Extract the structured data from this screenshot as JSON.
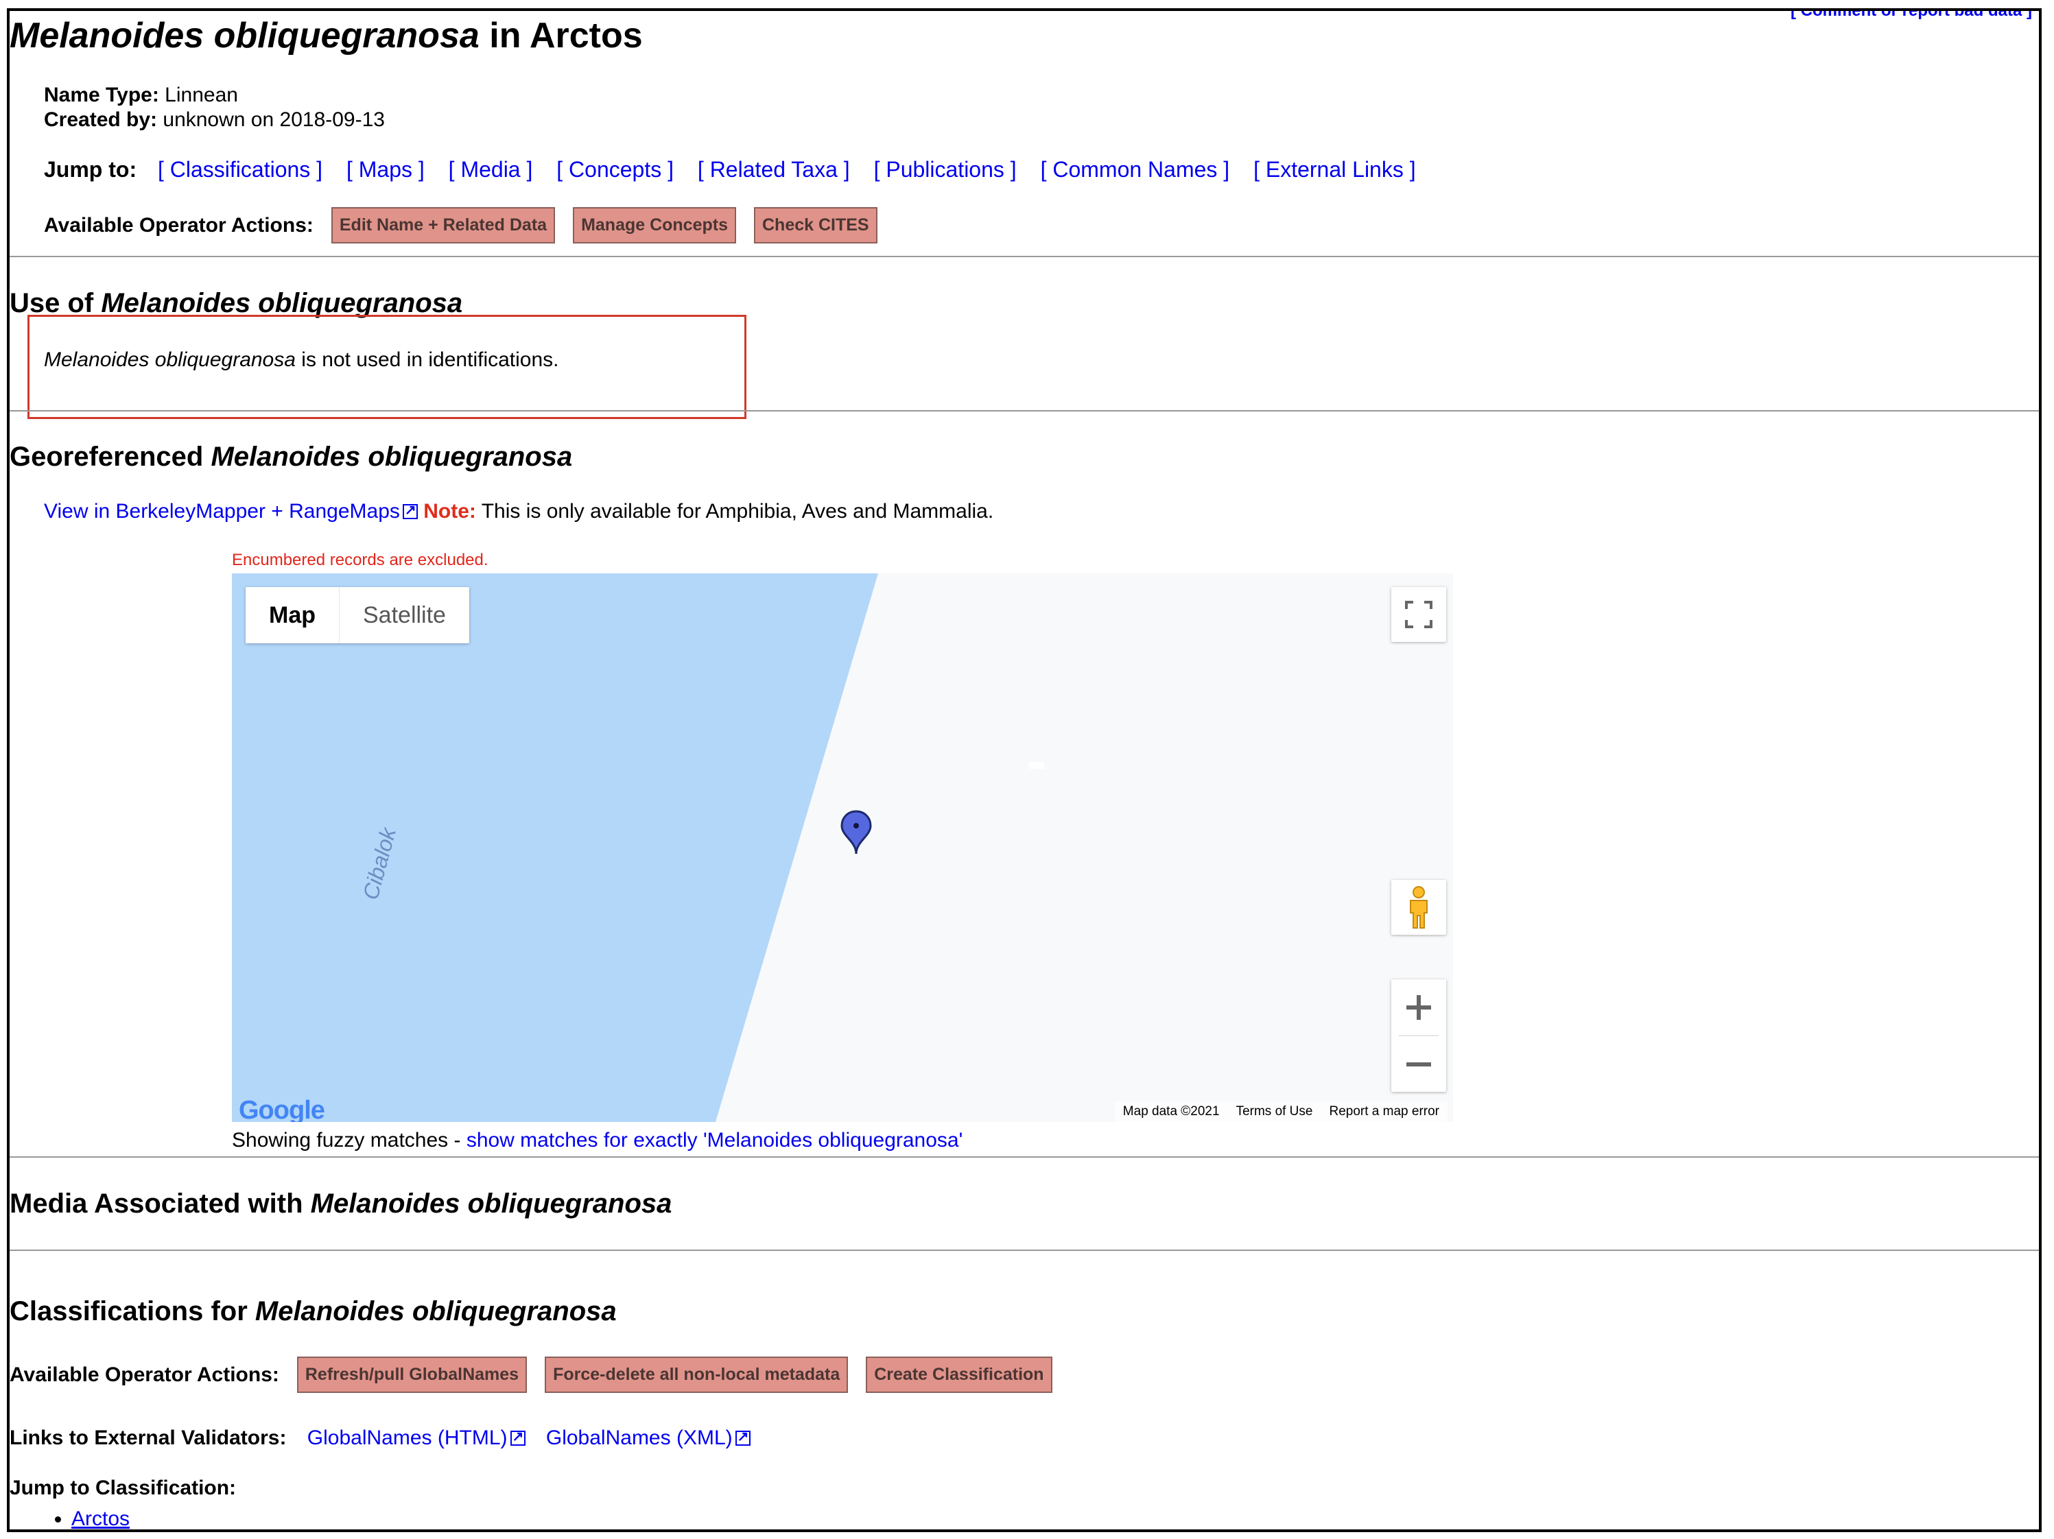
{
  "report_link": "[ Comment or report bad data ]",
  "title": {
    "taxon": "Melanoides obliquegranosa",
    "suffix": " in Arctos"
  },
  "info": {
    "name_type_label": "Name Type:",
    "name_type_value": " Linnean",
    "created_by_label": "Created by:",
    "created_by_value": " unknown on 2018-09-13"
  },
  "jump": {
    "label": "Jump to:",
    "links": [
      "[ Classifications ]",
      "[ Maps ]",
      "[ Media ]",
      "[ Concepts ]",
      "[ Related Taxa ]",
      "[ Publications ]",
      "[ Common Names ]",
      "[ External Links ]"
    ]
  },
  "operator_actions": {
    "label": "Available Operator Actions:",
    "buttons": [
      "Edit Name + Related Data",
      "Manage Concepts",
      "Check CITES"
    ]
  },
  "use_section": {
    "heading_prefix": "Use of ",
    "heading_taxon": "Melanoides obliquegranosa",
    "text_taxon": "Melanoides obliquegranosa",
    "text_rest": " is not used in identifications."
  },
  "geo_section": {
    "heading_prefix": "Georeferenced ",
    "heading_taxon": "Melanoides obliquegranosa",
    "mapper_link": "View in BerkeleyMapper + RangeMaps",
    "note_label": "Note:",
    "note_text": " This is only available for Amphibia, Aves and Mammalia.",
    "encumbered": "Encumbered records are excluded.",
    "map": {
      "type_map": "Map",
      "type_satellite": "Satellite",
      "place_label": "Cibalok",
      "google_logo": "Google",
      "attribution": [
        "Map data ©2021",
        "Terms of Use",
        "Report a map error"
      ],
      "water_color": "#b3d7f9",
      "land_color": "#f8f9fa",
      "pin_color": "#5668e0"
    },
    "fuzzy_prefix": "Showing fuzzy matches - ",
    "fuzzy_link": "show matches for exactly 'Melanoides obliquegranosa'"
  },
  "media_section": {
    "heading_prefix": "Media Associated with ",
    "heading_taxon": "Melanoides obliquegranosa"
  },
  "class_section": {
    "heading_prefix": "Classifications for ",
    "heading_taxon": "Melanoides obliquegranosa",
    "ops_label": "Available Operator Actions:",
    "buttons": [
      "Refresh/pull GlobalNames",
      "Force-delete all non-local metadata",
      "Create Classification"
    ],
    "validators_label": "Links to External Validators:",
    "validators": [
      "GlobalNames (HTML)",
      "GlobalNames (XML)"
    ],
    "jump_label": "Jump to Classification:",
    "classifications": [
      "Arctos"
    ]
  }
}
